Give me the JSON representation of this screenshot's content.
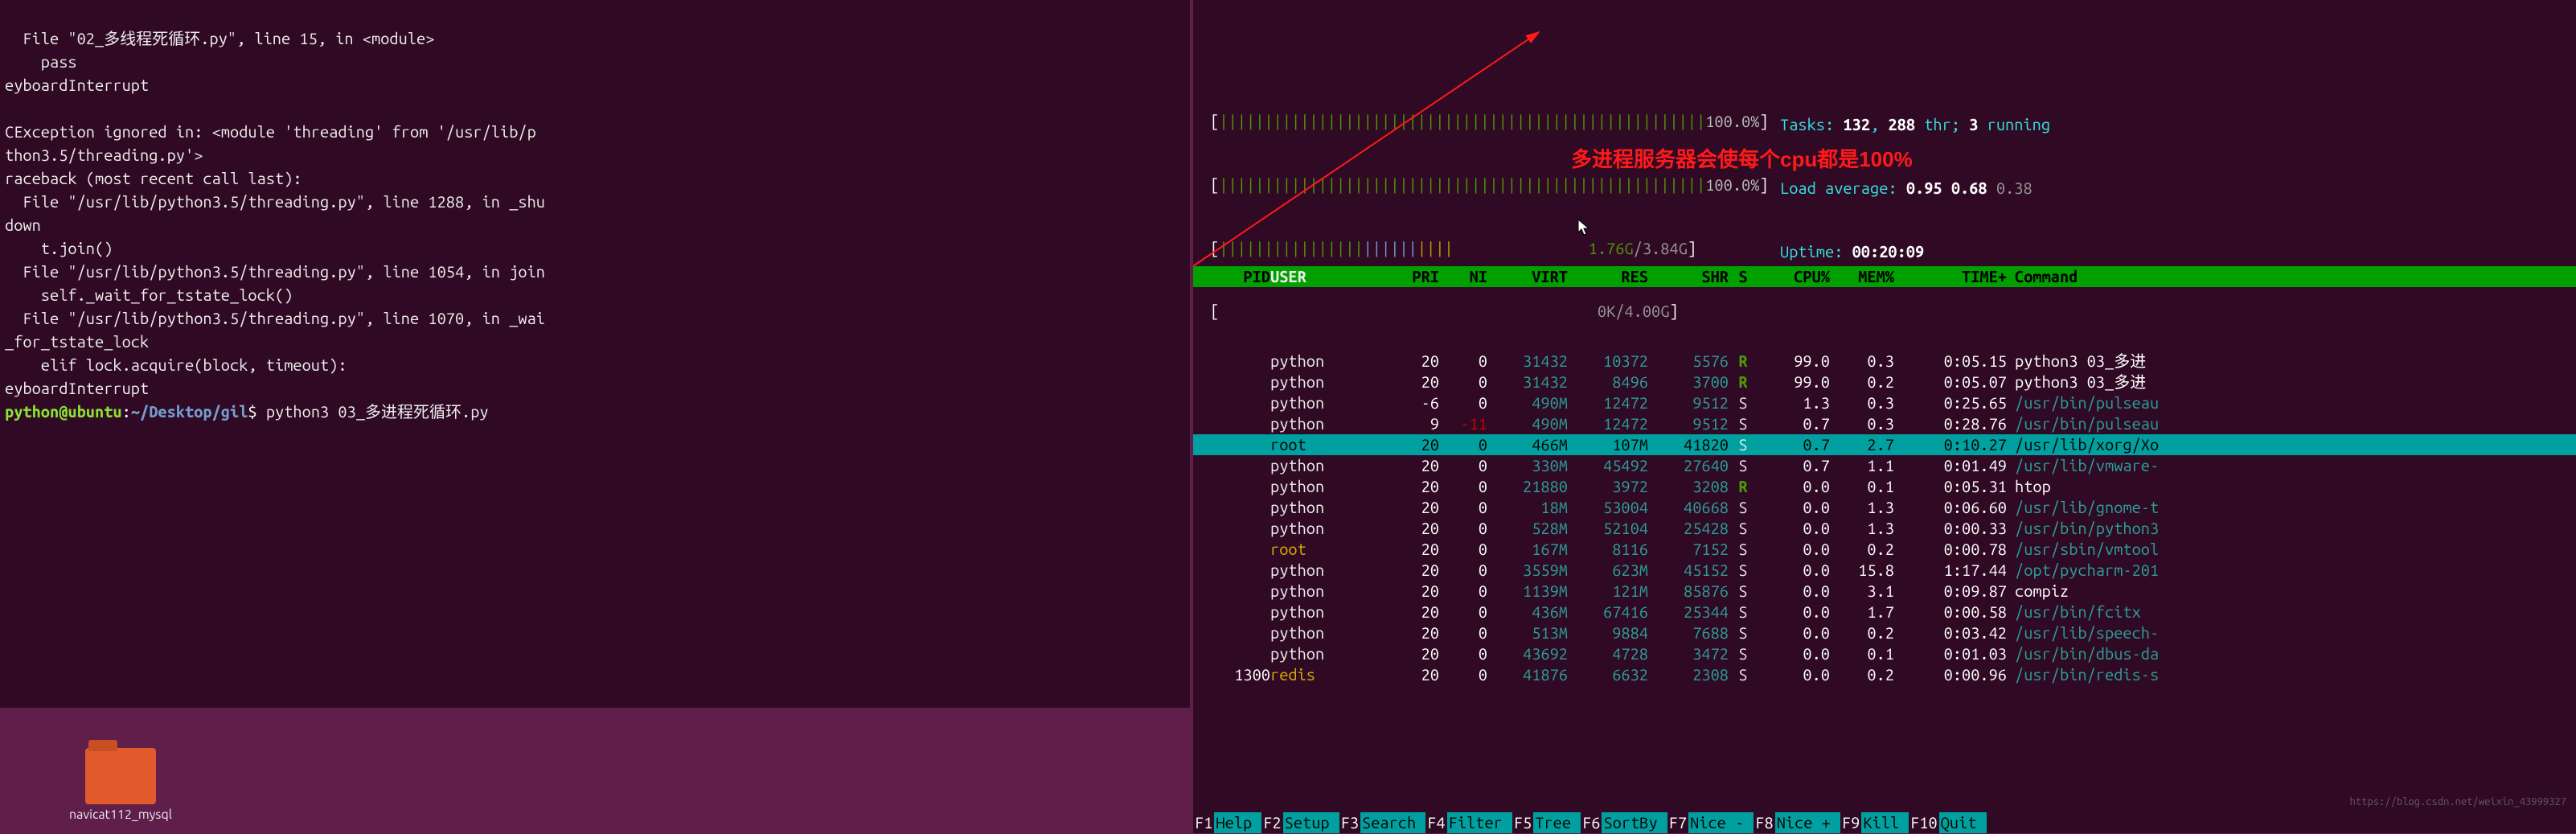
{
  "left_terminal": {
    "title": "python@ubuntu: ~/Desktop/gil",
    "lines": [
      "  File \"02_多线程死循环.py\", line 15, in <module>",
      "    pass",
      "eyboardInterrupt",
      "",
      "CException ignored in: <module 'threading' from '/usr/lib/p",
      "thon3.5/threading.py'>",
      "raceback (most recent call last):",
      "  File \"/usr/lib/python3.5/threading.py\", line 1288, in _shu",
      "down",
      "    t.join()",
      "  File \"/usr/lib/python3.5/threading.py\", line 1054, in join",
      "    self._wait_for_tstate_lock()",
      "  File \"/usr/lib/python3.5/threading.py\", line 1070, in _wai",
      "_for_tstate_lock",
      "    elif lock.acquire(block, timeout):",
      "eyboardInterrupt"
    ],
    "prompt": {
      "user": "python",
      "host": "ubuntu",
      "path": "~/Desktop/gil",
      "command": "python3 03_多进程死循环.py"
    }
  },
  "htop": {
    "cpu1_pct": "100.0%",
    "cpu2_pct": "100.0%",
    "mem_used": "1.76G",
    "mem_total": "3.84G",
    "swap_used": "0K",
    "swap_total": "4.00G",
    "tasks_label": "Tasks: ",
    "tasks_procs": "132",
    "tasks_sep1": ", ",
    "tasks_thr": "288",
    "tasks_thr_suffix": " thr; ",
    "tasks_running": "3",
    "tasks_running_suffix": " running",
    "load_label": "Load average: ",
    "load1": "0.95",
    "load5": "0.68",
    "load15": "0.38",
    "uptime_label": "Uptime: ",
    "uptime_val": "00:20:09",
    "annotation": "多进程服务器会使每个cpu都是100%",
    "headers": {
      "pid": "PID",
      "user": "USER",
      "pri": "PRI",
      "ni": "NI",
      "virt": "VIRT",
      "res": "RES",
      "shr": "SHR",
      "s": "S",
      "cpu": "CPU%",
      "mem": "MEM%",
      "time": "TIME+",
      "cmd": "Command"
    },
    "rows": [
      {
        "pid": "",
        "user": "python",
        "pri": "20",
        "ni": "0",
        "virt": "31432",
        "res": "10372",
        "shr": "5576",
        "s": "R",
        "cpu": "99.0",
        "mem": "0.3",
        "time": "0:05.15",
        "cmd": "python3 03_多进"
      },
      {
        "pid": "",
        "user": "python",
        "pri": "20",
        "ni": "0",
        "virt": "31432",
        "res": "8496",
        "shr": "3700",
        "s": "R",
        "cpu": "99.0",
        "mem": "0.2",
        "time": "0:05.07",
        "cmd": "python3 03_多进"
      },
      {
        "pid": "",
        "user": "python",
        "pri": "-6",
        "ni": "0",
        "virt": "490M",
        "res": "12472",
        "shr": "9512",
        "s": "S",
        "cpu": "1.3",
        "mem": "0.3",
        "time": "0:25.65",
        "cmd": "/usr/bin/pulseau",
        "cmdPath": true
      },
      {
        "pid": "",
        "user": "python",
        "pri": "9",
        "ni": "-11",
        "virt": "490M",
        "res": "12472",
        "shr": "9512",
        "s": "S",
        "cpu": "0.7",
        "mem": "0.3",
        "time": "0:28.76",
        "cmd": "/usr/bin/pulseau",
        "cmdPath": true
      },
      {
        "pid": "",
        "user": "root",
        "pri": "20",
        "ni": "0",
        "virt": "466M",
        "res": "107M",
        "shr": "41820",
        "s": "S",
        "cpu": "0.7",
        "mem": "2.7",
        "time": "0:10.27",
        "cmd": "/usr/lib/xorg/Xo",
        "hl": true
      },
      {
        "pid": "",
        "user": "python",
        "pri": "20",
        "ni": "0",
        "virt": "330M",
        "res": "45492",
        "shr": "27640",
        "s": "S",
        "cpu": "0.7",
        "mem": "1.1",
        "time": "0:01.49",
        "cmd": "/usr/lib/vmware-",
        "cmdPath": true
      },
      {
        "pid": "",
        "user": "python",
        "pri": "20",
        "ni": "0",
        "virt": "21880",
        "res": "3972",
        "shr": "3208",
        "s": "R",
        "cpu": "0.0",
        "mem": "0.1",
        "time": "0:05.31",
        "cmd": "htop"
      },
      {
        "pid": "",
        "user": "python",
        "pri": "20",
        "ni": "0",
        "virt": "18M",
        "res": "53004",
        "shr": "40668",
        "s": "S",
        "cpu": "0.0",
        "mem": "1.3",
        "time": "0:06.60",
        "cmd": "/usr/lib/gnome-t",
        "cmdPath": true
      },
      {
        "pid": "",
        "user": "python",
        "pri": "20",
        "ni": "0",
        "virt": "528M",
        "res": "52104",
        "shr": "25428",
        "s": "S",
        "cpu": "0.0",
        "mem": "1.3",
        "time": "0:00.33",
        "cmd": "/usr/bin/python3",
        "cmdPath": true
      },
      {
        "pid": "",
        "user": "root",
        "pri": "20",
        "ni": "0",
        "virt": "167M",
        "res": "8116",
        "shr": "7152",
        "s": "S",
        "cpu": "0.0",
        "mem": "0.2",
        "time": "0:00.78",
        "cmd": "/usr/sbin/vmtool",
        "cmdPath": true
      },
      {
        "pid": "",
        "user": "python",
        "pri": "20",
        "ni": "0",
        "virt": "3559M",
        "res": "623M",
        "shr": "45152",
        "s": "S",
        "cpu": "0.0",
        "mem": "15.8",
        "time": "1:17.44",
        "cmd": "/opt/pycharm-201",
        "cmdPath": true
      },
      {
        "pid": "",
        "user": "python",
        "pri": "20",
        "ni": "0",
        "virt": "1139M",
        "res": "121M",
        "shr": "85876",
        "s": "S",
        "cpu": "0.0",
        "mem": "3.1",
        "time": "0:09.87",
        "cmd": "compiz"
      },
      {
        "pid": "",
        "user": "python",
        "pri": "20",
        "ni": "0",
        "virt": "436M",
        "res": "67416",
        "shr": "25344",
        "s": "S",
        "cpu": "0.0",
        "mem": "1.7",
        "time": "0:00.58",
        "cmd": "/usr/bin/fcitx",
        "cmdPath": true
      },
      {
        "pid": "",
        "user": "python",
        "pri": "20",
        "ni": "0",
        "virt": "513M",
        "res": "9884",
        "shr": "7688",
        "s": "S",
        "cpu": "0.0",
        "mem": "0.2",
        "time": "0:03.42",
        "cmd": "/usr/lib/speech-",
        "cmdPath": true
      },
      {
        "pid": "",
        "user": "python",
        "pri": "20",
        "ni": "0",
        "virt": "43692",
        "res": "4728",
        "shr": "3472",
        "s": "S",
        "cpu": "0.0",
        "mem": "0.1",
        "time": "0:01.03",
        "cmd": "/usr/bin/dbus-da",
        "cmdPath": true
      },
      {
        "pid": "1300",
        "user": "redis",
        "pri": "20",
        "ni": "0",
        "virt": "41876",
        "res": "6632",
        "shr": "2308",
        "s": "S",
        "cpu": "0.0",
        "mem": "0.2",
        "time": "0:00.96",
        "cmd": "/usr/bin/redis-s",
        "cmdPath": true
      }
    ],
    "fnkeys": [
      {
        "n": "F1",
        "l": "Help"
      },
      {
        "n": "F2",
        "l": "Setup"
      },
      {
        "n": "F3",
        "l": "Search"
      },
      {
        "n": "F4",
        "l": "Filter"
      },
      {
        "n": "F5",
        "l": "Tree"
      },
      {
        "n": "F6",
        "l": "SortBy"
      },
      {
        "n": "F7",
        "l": "Nice -"
      },
      {
        "n": "F8",
        "l": "Nice +"
      },
      {
        "n": "F9",
        "l": "Kill"
      },
      {
        "n": "F10",
        "l": "Quit"
      }
    ]
  },
  "desktop": {
    "folder_label": "navicat112_mysql"
  },
  "watermark": "https://blog.csdn.net/weixin_43999327"
}
